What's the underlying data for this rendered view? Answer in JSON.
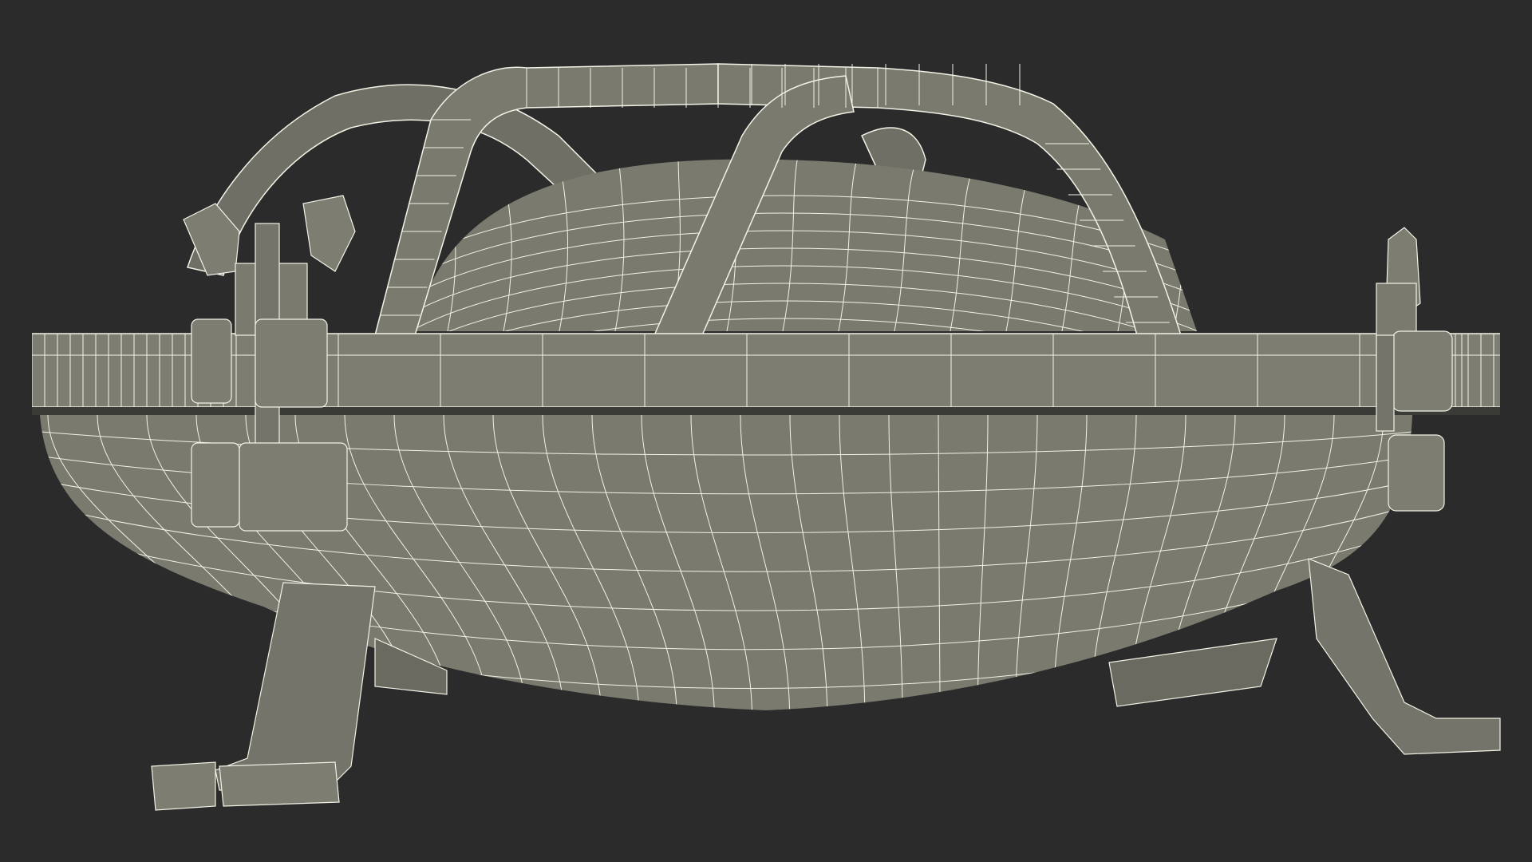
{
  "scene": {
    "background_color": "#2b2b2b",
    "model_fill_color": "#7a7a6f",
    "model_shadow_color": "#65655c",
    "model_highlight_color": "#8c8c80",
    "wireframe_color": "#f2f2e6",
    "subject": "wireframe-render-of-lantern-with-cage-and-feet"
  }
}
